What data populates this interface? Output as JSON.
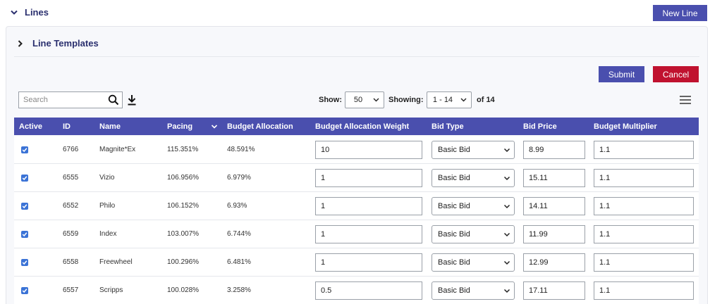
{
  "header": {
    "title": "Lines",
    "new_line_label": "New Line"
  },
  "templates": {
    "title": "Line Templates"
  },
  "actions": {
    "submit_label": "Submit",
    "cancel_label": "Cancel"
  },
  "toolbar": {
    "search_placeholder": "Search",
    "show_label": "Show:",
    "show_value": "50",
    "showing_label": "Showing:",
    "showing_value": "1 - 14",
    "of_label": "of 14"
  },
  "table": {
    "columns": [
      "Active",
      "ID",
      "Name",
      "Pacing",
      "Budget Allocation",
      "Budget Allocation Weight",
      "Bid Type",
      "Bid Price",
      "Budget Multiplier"
    ],
    "rows": [
      {
        "active": true,
        "id": "6766",
        "name": "Magnite*Ex",
        "pacing": "115.351%",
        "budget_allocation": "48.591%",
        "weight": "10",
        "bid_type": "Basic Bid",
        "bid_price": "8.99",
        "multiplier": "1.1"
      },
      {
        "active": true,
        "id": "6555",
        "name": "Vizio",
        "pacing": "106.956%",
        "budget_allocation": "6.979%",
        "weight": "1",
        "bid_type": "Basic Bid",
        "bid_price": "15.11",
        "multiplier": "1.1"
      },
      {
        "active": true,
        "id": "6552",
        "name": "Philo",
        "pacing": "106.152%",
        "budget_allocation": "6.93%",
        "weight": "1",
        "bid_type": "Basic Bid",
        "bid_price": "14.11",
        "multiplier": "1.1"
      },
      {
        "active": true,
        "id": "6559",
        "name": "Index",
        "pacing": "103.007%",
        "budget_allocation": "6.744%",
        "weight": "1",
        "bid_type": "Basic Bid",
        "bid_price": "11.99",
        "multiplier": "1.1"
      },
      {
        "active": true,
        "id": "6558",
        "name": "Freewheel",
        "pacing": "100.296%",
        "budget_allocation": "6.481%",
        "weight": "1",
        "bid_type": "Basic Bid",
        "bid_price": "12.99",
        "multiplier": "1.1"
      },
      {
        "active": true,
        "id": "6557",
        "name": "Scripps",
        "pacing": "100.028%",
        "budget_allocation": "3.258%",
        "weight": "0.5",
        "bid_type": "Basic Bid",
        "bid_price": "17.11",
        "multiplier": "1.1"
      }
    ]
  },
  "colors": {
    "primary": "#4a4fae",
    "danger": "#c0122f",
    "title": "#2a2f6e",
    "checkbox": "#3b73d6"
  }
}
